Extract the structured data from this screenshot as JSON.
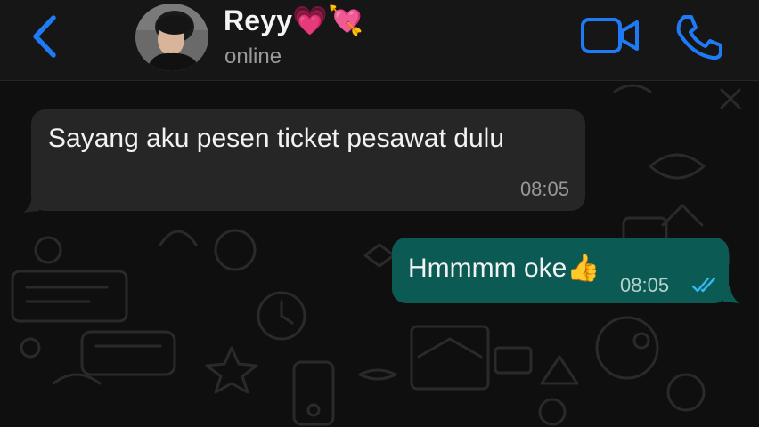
{
  "header": {
    "contact_name": "Reyy💗💘",
    "status": "online",
    "icons": {
      "back": "chevron-left-icon",
      "video": "video-camera-icon",
      "call": "phone-icon"
    },
    "accent_color": "#1f7bf5"
  },
  "messages": [
    {
      "direction": "incoming",
      "text": "Sayang aku pesen ticket pesawat dulu",
      "time": "08:05"
    },
    {
      "direction": "outgoing",
      "text": "Hmmmm oke👍",
      "time": "08:05",
      "status_icon": "double-check-icon"
    }
  ],
  "theme": {
    "background": "#0f0f0f",
    "incoming_bubble": "#262626",
    "outgoing_bubble": "#0b5b54",
    "read_tick_color": "#34b7f1"
  }
}
